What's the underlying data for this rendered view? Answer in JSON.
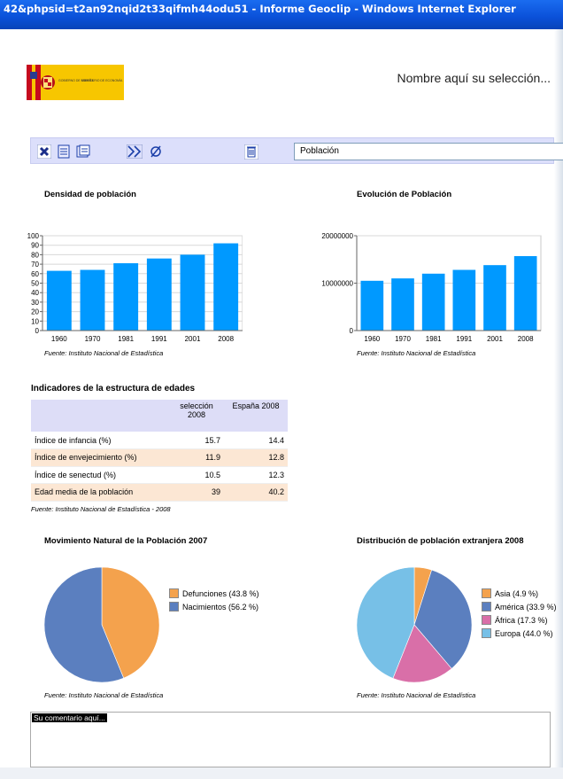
{
  "window": {
    "title": "42&phpsid=t2an92nqid2t33qifmh44odu51 - Informe Geoclip - Windows Internet Explorer"
  },
  "header": {
    "logo_line1": "GOBIERNO DE ESPAÑA",
    "logo_line2": "MINISTERIO DE ECONOMÍA",
    "selection_text": "Nombre aquí su selección..."
  },
  "toolbar": {
    "icons": [
      "close-icon",
      "print-icon",
      "print-preview-icon",
      "next-icon",
      "clear-icon",
      "trash-icon"
    ],
    "selected_indicator": "Población"
  },
  "colors": {
    "bar": "#0099ff",
    "orange": "#f4a24d",
    "blue": "#5b7fbf",
    "pink": "#d96fa8",
    "lightblue": "#77c0e7",
    "toolbar": "#dcdffb"
  },
  "chart_data": [
    {
      "type": "bar",
      "title": "Densidad de población",
      "categories": [
        "1960",
        "1970",
        "1981",
        "1991",
        "2001",
        "2008"
      ],
      "values": [
        63,
        64,
        71,
        76,
        80,
        92
      ],
      "ylim": [
        0,
        100
      ],
      "yticks": [
        "0",
        "10",
        "20",
        "30",
        "40",
        "50",
        "60",
        "70",
        "80",
        "90",
        "100"
      ],
      "grid": true,
      "source": "Fuente: Instituto Nacional de Estadística"
    },
    {
      "type": "bar",
      "title": "Evolución de Población",
      "categories": [
        "1960",
        "1970",
        "1981",
        "1991",
        "2001",
        "2008"
      ],
      "values": [
        10500000,
        11000000,
        12000000,
        12800000,
        13800000,
        15700000
      ],
      "ylim": [
        0,
        20000000
      ],
      "yticks": [
        "0",
        "10000000",
        "20000000"
      ],
      "grid": true,
      "source": "Fuente: Instituto Nacional de Estadística"
    },
    {
      "type": "pie",
      "title": "Movimiento Natural de la Población 2007",
      "labels": [
        "Defunciones (43.8 %)",
        "Nacimientos (56.2 %)"
      ],
      "values": [
        43.8,
        56.2
      ],
      "legend": "right",
      "source": "Fuente: Instituto Nacional de Estadística"
    },
    {
      "type": "pie",
      "title": "Distribución de población extranjera 2008",
      "labels": [
        "Asia (4.9 %)",
        "América (33.9 %)",
        "África (17.3 %)",
        "Europa (44.0 %)"
      ],
      "values": [
        4.9,
        33.9,
        17.3,
        44.0
      ],
      "legend": "right",
      "source": "Fuente: Instituto Nacional de Estadística"
    }
  ],
  "table": {
    "title": "Indicadores de la estructura de edades",
    "columns": [
      "",
      "selección 2008",
      "España 2008"
    ],
    "rows": [
      [
        "Índice de infancia (%)",
        "15.7",
        "14.4"
      ],
      [
        "Índice de envejecimiento (%)",
        "11.9",
        "12.8"
      ],
      [
        "Índice de senectud (%)",
        "10.5",
        "12.3"
      ],
      [
        "Edad media de la población",
        "39",
        "40.2"
      ]
    ],
    "source": "Fuente: Instituto Nacional de Estadística - 2008"
  },
  "comment": {
    "label": "Su comentario aquí..."
  }
}
